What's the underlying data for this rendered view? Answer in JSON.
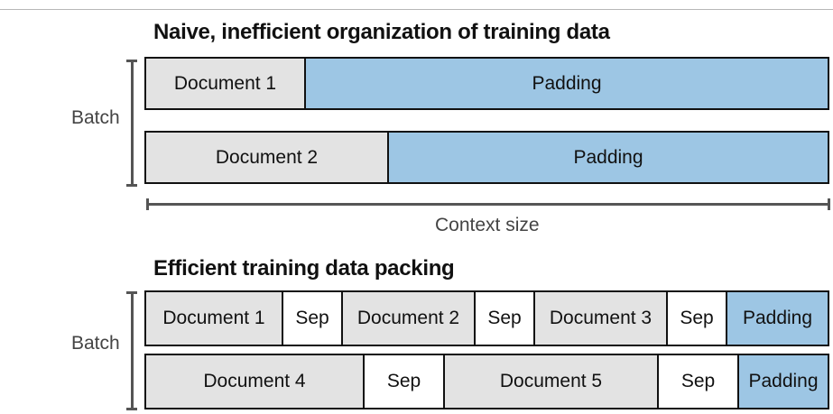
{
  "naive": {
    "title": "Naive, inefficient organization of training data",
    "batch_label": "Batch",
    "rows": [
      [
        {
          "label": "Document 1",
          "kind": "doc"
        },
        {
          "label": "Padding",
          "kind": "pad"
        }
      ],
      [
        {
          "label": "Document 2",
          "kind": "doc"
        },
        {
          "label": "Padding",
          "kind": "pad"
        }
      ]
    ],
    "context_label": "Context size"
  },
  "packed": {
    "title": "Efficient training data packing",
    "batch_label": "Batch",
    "rows": [
      [
        {
          "label": "Document 1",
          "kind": "doc"
        },
        {
          "label": "Sep",
          "kind": "sep"
        },
        {
          "label": "Document 2",
          "kind": "doc"
        },
        {
          "label": "Sep",
          "kind": "sep"
        },
        {
          "label": "Document 3",
          "kind": "doc"
        },
        {
          "label": "Sep",
          "kind": "sep"
        },
        {
          "label": "Padding",
          "kind": "pad"
        }
      ],
      [
        {
          "label": "Document 4",
          "kind": "doc"
        },
        {
          "label": "Sep",
          "kind": "sep"
        },
        {
          "label": "Document 5",
          "kind": "doc"
        },
        {
          "label": "Sep",
          "kind": "sep"
        },
        {
          "label": "Padding",
          "kind": "pad"
        }
      ]
    ]
  },
  "colors": {
    "document": "#e3e3e3",
    "padding": "#9dc6e4",
    "separator": "#ffffff",
    "border": "#111111"
  }
}
